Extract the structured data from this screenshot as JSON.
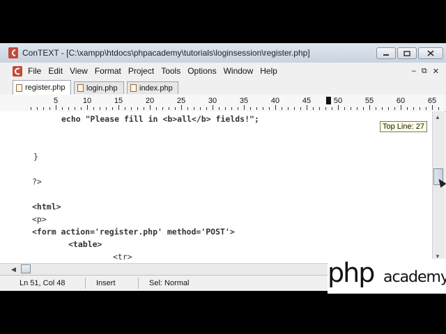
{
  "window": {
    "title": "ConTEXT - [C:\\xampp\\htdocs\\phpacademy\\tutorials\\loginsession\\register.php]"
  },
  "menu": {
    "items": [
      "File",
      "Edit",
      "View",
      "Format",
      "Project",
      "Tools",
      "Options",
      "Window",
      "Help"
    ]
  },
  "tabs": [
    {
      "label": "register.php",
      "active": true
    },
    {
      "label": "login.php",
      "active": false
    },
    {
      "label": "index.php",
      "active": false
    }
  ],
  "ruler": {
    "labels": [
      "5",
      "10",
      "15",
      "20",
      "25",
      "30",
      "35",
      "40",
      "45",
      "50",
      "55",
      "60",
      "65"
    ]
  },
  "editor": {
    "lines": [
      "echo \"Please fill in <b>all</b> fields!\";",
      "}",
      "?>",
      "<html>",
      "<p>",
      "<form action='register.php' method='POST'>",
      "<table>",
      "<tr>"
    ],
    "tooltip": "Top Line: 27"
  },
  "status": {
    "position": "Ln 51, Col 48",
    "mode": "Insert",
    "selection": "Sel: Normal"
  },
  "watermark": {
    "brand_php": "php",
    "brand_academy": "academy"
  }
}
